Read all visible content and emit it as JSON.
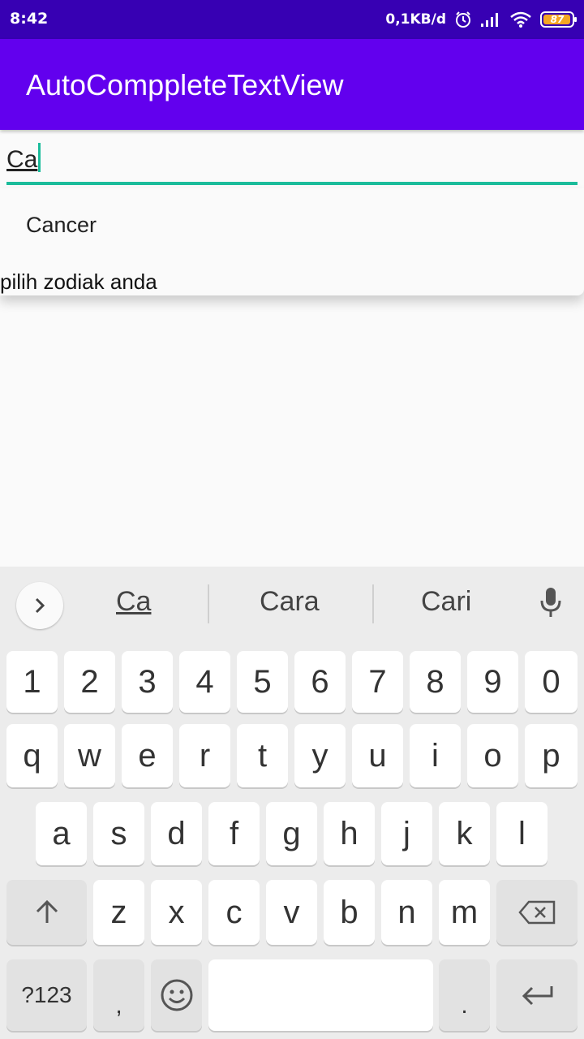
{
  "status_bar": {
    "time": "8:42",
    "speed": "0,1KB/d",
    "battery": "87"
  },
  "app_bar": {
    "title": "AutoComppleteTextView"
  },
  "input": {
    "value": "Ca"
  },
  "dropdown": {
    "items": [
      "Cancer"
    ],
    "hint": "pilih zodiak anda"
  },
  "keyboard": {
    "suggestions": [
      "Ca",
      "Cara",
      "Cari"
    ],
    "row_numbers": [
      "1",
      "2",
      "3",
      "4",
      "5",
      "6",
      "7",
      "8",
      "9",
      "0"
    ],
    "row1": [
      "q",
      "w",
      "e",
      "r",
      "t",
      "y",
      "u",
      "i",
      "o",
      "p"
    ],
    "row2": [
      "a",
      "s",
      "d",
      "f",
      "g",
      "h",
      "j",
      "k",
      "l"
    ],
    "row3": [
      "z",
      "x",
      "c",
      "v",
      "b",
      "n",
      "m"
    ],
    "symbols_label": "?123",
    "comma": ",",
    "period": "."
  },
  "colors": {
    "status_bar": "#3700b3",
    "app_bar": "#6200ee",
    "accent": "#1bbc9b"
  }
}
